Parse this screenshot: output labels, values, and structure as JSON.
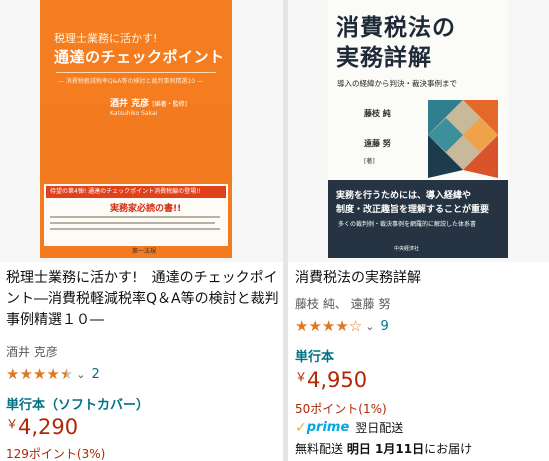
{
  "products": [
    {
      "cover": {
        "subtitle": "税理士業務に活かす!",
        "title": "通達のチェックポイント",
        "small": "— 消費税軽減税率Q&A等の検討と裁判事例精選10 —",
        "author": "酒井 克彦",
        "author_role": "[編著・監修]",
        "author_en": "Katsuhiko Sakai",
        "banner": "待望の第4弾! 通達のチェックポイント消費税編の登場!!",
        "catch": "実務家必読の書!!",
        "publisher": "第一法規"
      },
      "title": "税理士業務に活かす!　通達のチェックポイント―消費税軽減税率Q＆A等の検討と裁判事例精選１０―",
      "author": "酒井 克彦",
      "rating_count": "2",
      "format": "単行本（ソフトカバー）",
      "price_symbol": "￥",
      "price": "4,290",
      "points": "129ポイント(3%)"
    },
    {
      "cover": {
        "title_line1": "消費税法の",
        "title_line2": "実務詳解",
        "subtitle": "導入の経緯から判決・裁決事例まで",
        "author1": "藤枝 純",
        "author2": "遠藤 努",
        "role": "[著]",
        "band1": "実務を行うためには、導入経緯や",
        "band2": "制度・改正趣旨を理解することが重要",
        "band3": "多くの裁判例・裁決事例を網羅的に解説した体系書",
        "publisher": "中央経済社"
      },
      "title": "消費税法の実務詳解",
      "author": "藤枝 純、 遠藤 努",
      "rating_count": "9",
      "format": "単行本",
      "price_symbol": "￥",
      "price": "4,950",
      "points": "50ポイント(1%)",
      "prime_label": "prime",
      "prime_delivery": "翌日配送",
      "shipping_prefix": "無料配送",
      "shipping_date": "明日 1月11日",
      "shipping_suffix": "にお届け"
    }
  ],
  "ratings": [
    4.5,
    4.0
  ],
  "colors": {
    "star": "#de7921",
    "link": "#007185",
    "price": "#b12704",
    "prime": "#00a8e1"
  }
}
